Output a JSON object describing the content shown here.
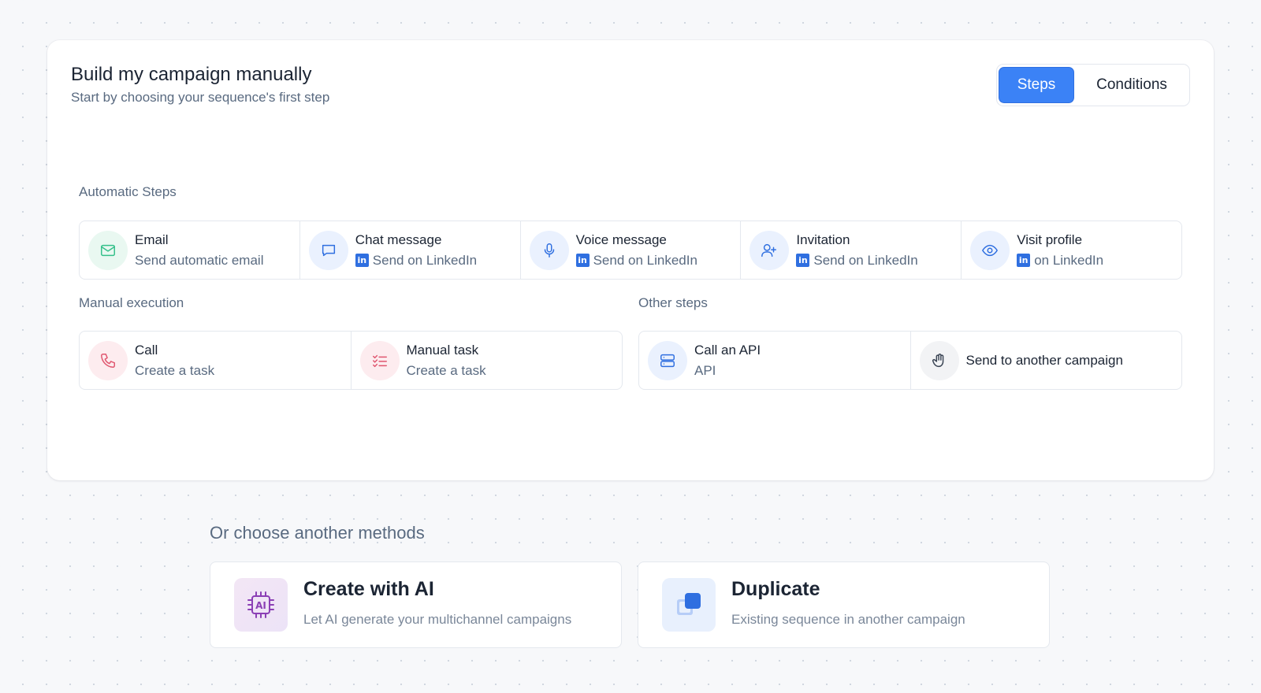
{
  "header": {
    "title": "Build my campaign manually",
    "subtitle": "Start by choosing your sequence's first step"
  },
  "toggle": {
    "steps_label": "Steps",
    "conditions_label": "Conditions",
    "active": "Steps"
  },
  "automatic": {
    "label": "Automatic Steps",
    "items": [
      {
        "title": "Email",
        "subtitle": "Send automatic email",
        "icon": "mail-icon",
        "linkedin": false
      },
      {
        "title": "Chat message",
        "subtitle": "Send on LinkedIn",
        "icon": "chat-icon",
        "linkedin": true
      },
      {
        "title": "Voice message",
        "subtitle": "Send on LinkedIn",
        "icon": "microphone-icon",
        "linkedin": true
      },
      {
        "title": "Invitation",
        "subtitle": "Send on LinkedIn",
        "icon": "user-plus-icon",
        "linkedin": true
      },
      {
        "title": "Visit profile",
        "subtitle": "on LinkedIn",
        "icon": "eye-icon",
        "linkedin": true
      }
    ]
  },
  "manual": {
    "label": "Manual execution",
    "items": [
      {
        "title": "Call",
        "subtitle": "Create a task",
        "icon": "phone-icon"
      },
      {
        "title": "Manual task",
        "subtitle": "Create a task",
        "icon": "checklist-icon"
      }
    ]
  },
  "other": {
    "label": "Other steps",
    "items": [
      {
        "title": "Call an API",
        "subtitle": "API",
        "icon": "server-icon"
      },
      {
        "title": "Send to another campaign",
        "icon": "hand-icon"
      }
    ]
  },
  "methods": {
    "title": "Or choose another methods",
    "items": [
      {
        "title": "Create with AI",
        "subtitle": "Let AI generate your multichannel campaigns",
        "icon": "ai-chip-icon",
        "icon_text": "AI"
      },
      {
        "title": "Duplicate",
        "subtitle": "Existing sequence in another campaign",
        "icon": "duplicate-icon"
      }
    ]
  },
  "linkedin_glyph": "in",
  "colors": {
    "primary": "#3b82f6",
    "email_icon": "#34c08a",
    "linkedin": "#2f6fe0",
    "manual_icon": "#e0566f",
    "ai_icon": "#8b3fb5"
  }
}
